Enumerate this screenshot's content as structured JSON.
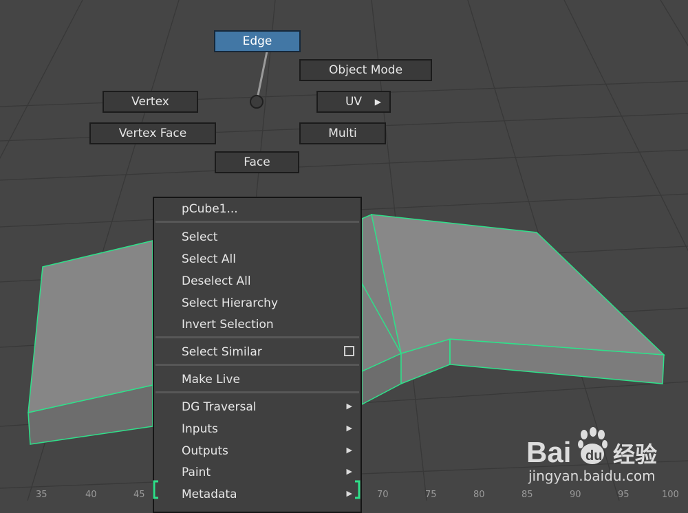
{
  "marking_menu": {
    "items": {
      "edge": "Edge",
      "object_mode": "Object Mode",
      "vertex": "Vertex",
      "uv": "UV",
      "vertex_face": "Vertex Face",
      "multi": "Multi",
      "face": "Face"
    },
    "active_color": "#4277a5"
  },
  "context_menu": {
    "title": "pCube1...",
    "items": [
      {
        "label": "Select"
      },
      {
        "label": "Select All"
      },
      {
        "label": "Deselect All"
      },
      {
        "label": "Select Hierarchy"
      },
      {
        "label": "Invert Selection"
      },
      {
        "label": "Select Similar",
        "option_box": true
      },
      {
        "label": "Make Live"
      },
      {
        "label": "DG Traversal",
        "submenu": true
      },
      {
        "label": "Inputs",
        "submenu": true
      },
      {
        "label": "Outputs",
        "submenu": true
      },
      {
        "label": "Paint",
        "submenu": true
      },
      {
        "label": "Metadata",
        "submenu": true
      }
    ]
  },
  "timeline": {
    "ticks": [
      "35",
      "40",
      "45",
      "70",
      "75",
      "80",
      "85",
      "90",
      "95",
      "100"
    ]
  },
  "viewport": {
    "selection_color": "#2fe08a",
    "mesh_color": "#818181"
  },
  "watermark": {
    "logo_text": "Bai du 经验",
    "url": "jingyan.baidu.com"
  }
}
